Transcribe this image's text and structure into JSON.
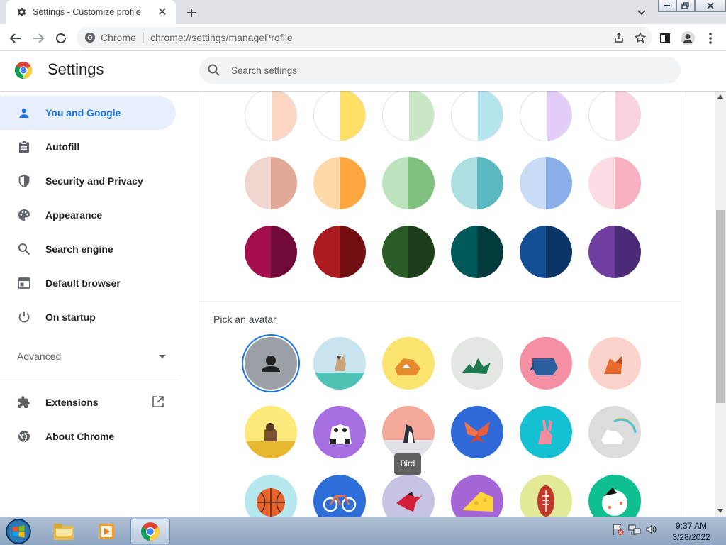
{
  "browser": {
    "tab_title": "Settings - Customize profile",
    "omnibox_site": "Chrome",
    "omnibox_url": "chrome://settings/manageProfile"
  },
  "settings": {
    "title": "Settings",
    "search_placeholder": "Search settings"
  },
  "sidebar": {
    "items": [
      {
        "label": "You and Google",
        "icon": "person-icon",
        "active": true
      },
      {
        "label": "Autofill",
        "icon": "clipboard-icon"
      },
      {
        "label": "Security and Privacy",
        "icon": "shield-icon"
      },
      {
        "label": "Appearance",
        "icon": "palette-icon"
      },
      {
        "label": "Search engine",
        "icon": "search-icon"
      },
      {
        "label": "Default browser",
        "icon": "browser-window-icon"
      },
      {
        "label": "On startup",
        "icon": "power-icon"
      }
    ],
    "advanced_label": "Advanced",
    "extensions_label": "Extensions",
    "about_label": "About Chrome"
  },
  "content": {
    "theme_colors": [
      [
        "#fde1d3",
        "#fbd6c2",
        "#ffe066",
        "#ffe066",
        "#d6efd3",
        "#c8e8c4",
        "#c8eef4",
        "#b4e4ee",
        "#ebe0fb",
        "#e1cdf8",
        "#fbe4ea",
        "#f8d3df"
      ],
      [
        "#efd5ce",
        "#e2a999",
        "#fed9a7",
        "#fea640",
        "#bce3bc",
        "#80c17f",
        "#addfe0",
        "#59b8c0",
        "#c8dcf6",
        "#8aaeea",
        "#fbdde3",
        "#f9b0c1"
      ],
      [
        "#a60f4d",
        "#720a3a",
        "#ab1b1f",
        "#740f13",
        "#295c27",
        "#1d3e1d",
        "#015a5a",
        "#023b3b",
        "#134f94",
        "#0a3566",
        "#6f3ea1",
        "#4b2a78"
      ]
    ],
    "pick_avatar_label": "Pick an avatar",
    "avatars": [
      {
        "name": "default-avatar",
        "bg": "#9aa0a6",
        "selected": true
      },
      {
        "name": "cat-avatar",
        "bg": "#c9e4ee"
      },
      {
        "name": "corgi-avatar",
        "bg": "#fbe36f"
      },
      {
        "name": "dragon-avatar",
        "bg": "#e4e6e3"
      },
      {
        "name": "elephant-avatar",
        "bg": "#f48fa4"
      },
      {
        "name": "fox-avatar",
        "bg": "#fbd3cc"
      },
      {
        "name": "monkey-avatar",
        "bg": "#fde87a"
      },
      {
        "name": "panda-avatar",
        "bg": "#a76ee2"
      },
      {
        "name": "penguin-avatar",
        "bg": "#f4a89a"
      },
      {
        "name": "butterfly-avatar",
        "bg": "#2f6ad8"
      },
      {
        "name": "rabbit-avatar",
        "bg": "#15c0d2"
      },
      {
        "name": "unicorn-avatar",
        "bg": "#dcdcdc"
      },
      {
        "name": "basketball-avatar",
        "bg": "#b6e6ee"
      },
      {
        "name": "bike-avatar",
        "bg": "#2e6ed8"
      },
      {
        "name": "bird-avatar",
        "bg": "#c6c4e2"
      },
      {
        "name": "cheese-avatar",
        "bg": "#a565d6"
      },
      {
        "name": "football-avatar",
        "bg": "#e3ea97"
      },
      {
        "name": "sushi-avatar",
        "bg": "#0fbf90"
      }
    ],
    "tooltip": "Bird"
  },
  "taskbar": {
    "time": "9:37 AM",
    "date": "3/28/2022"
  },
  "colors": {
    "accent": "#1a73e8",
    "active_bg": "#e8f0fe"
  }
}
